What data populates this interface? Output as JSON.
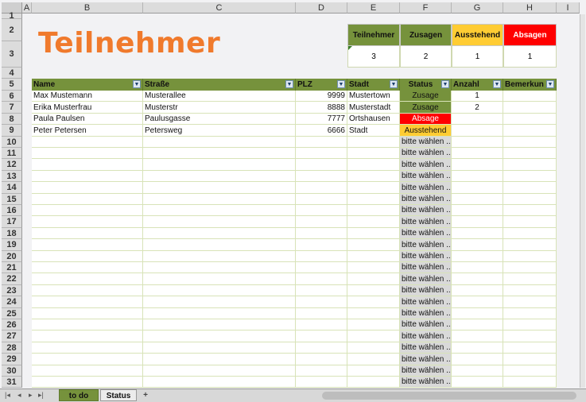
{
  "columns": [
    "A",
    "B",
    "C",
    "D",
    "E",
    "F",
    "G",
    "H",
    "I"
  ],
  "rows": [
    "1",
    "2",
    "3",
    "4",
    "5",
    "6",
    "7",
    "8",
    "9",
    "10",
    "11",
    "12",
    "13",
    "14",
    "15",
    "16",
    "17",
    "18",
    "19",
    "20",
    "21",
    "22",
    "23",
    "24",
    "25",
    "26",
    "27",
    "28",
    "29",
    "30",
    "31"
  ],
  "title": "Teilnehmer",
  "summary": {
    "headers": [
      "Teilnehmer",
      "Zusagen",
      "Ausstehend",
      "Absagen"
    ],
    "values": [
      "3",
      "2",
      "1",
      "1"
    ],
    "colors": [
      "#76923c",
      "#76923c",
      "#ffcc33",
      "#ff0000"
    ]
  },
  "table": {
    "headers": [
      "Name",
      "Straße",
      "PLZ",
      "Stadt",
      "Status",
      "Anzahl",
      "Bemerkun"
    ],
    "rows": [
      {
        "name": "Max Mustemann",
        "strasse": "Musterallee",
        "plz": "9999",
        "stadt": "Mustertown",
        "status": "Zusage",
        "anzahl": "1"
      },
      {
        "name": "Erika Musterfrau",
        "strasse": "Musterstr",
        "plz": "8888",
        "stadt": "Musterstadt",
        "status": "Zusage",
        "anzahl": "2"
      },
      {
        "name": "Paula Paulsen",
        "strasse": "Paulusgasse",
        "plz": "7777",
        "stadt": "Ortshausen",
        "status": "Absage",
        "anzahl": ""
      },
      {
        "name": "Peter Petersen",
        "strasse": "Petersweg",
        "plz": "6666",
        "stadt": "Stadt",
        "status": "Ausstehend",
        "anzahl": ""
      }
    ],
    "placeholder_status": "bitte wählen ...",
    "placeholder_count": 22
  },
  "tabs": [
    {
      "label": "to do",
      "active": true
    },
    {
      "label": "Status",
      "active": false
    }
  ],
  "add_tab": "+",
  "nav": [
    "|◂",
    "◂",
    "▸",
    "▸|"
  ],
  "colors": {
    "accent_green": "#76923c",
    "title_orange": "#f07a2c",
    "absage_red": "#ff0000",
    "ausstehend_yellow": "#ffcc33"
  }
}
